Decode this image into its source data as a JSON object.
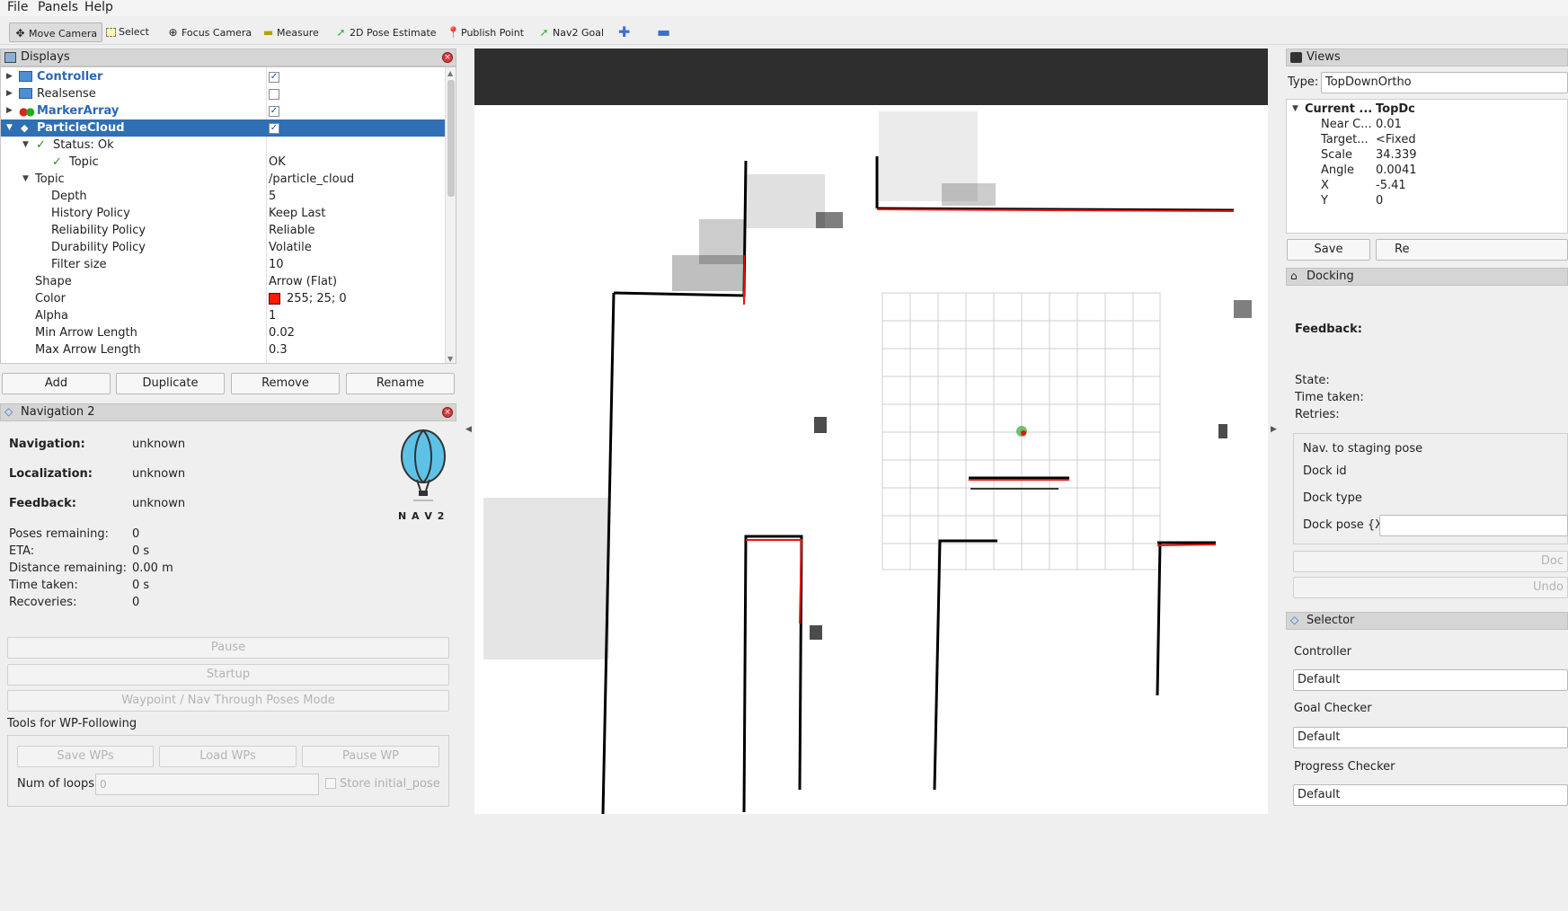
{
  "menu": {
    "file": "File",
    "panels": "Panels",
    "help": "Help"
  },
  "toolbar": {
    "move_camera": "Move Camera",
    "select": "Select",
    "focus_camera": "Focus Camera",
    "measure": "Measure",
    "pose_estimate": "2D Pose Estimate",
    "publish_point": "Publish Point",
    "nav2_goal": "Nav2 Goal"
  },
  "displays": {
    "title": "Displays",
    "items": [
      {
        "label": "Controller",
        "checked": true
      },
      {
        "label": "Realsense",
        "checked": false
      },
      {
        "label": "MarkerArray",
        "checked": true
      },
      {
        "label": "ParticleCloud",
        "checked": true
      }
    ],
    "status": "Status: Ok",
    "topic_status_label": "Topic",
    "topic_status_value": "OK",
    "props": {
      "topic": {
        "label": "Topic",
        "value": "/particle_cloud"
      },
      "depth": {
        "label": "Depth",
        "value": "5"
      },
      "history": {
        "label": "History Policy",
        "value": "Keep Last"
      },
      "reliability": {
        "label": "Reliability Policy",
        "value": "Reliable"
      },
      "durability": {
        "label": "Durability Policy",
        "value": "Volatile"
      },
      "filter": {
        "label": "Filter size",
        "value": "10"
      },
      "shape": {
        "label": "Shape",
        "value": "Arrow (Flat)"
      },
      "color": {
        "label": "Color",
        "value": "255; 25; 0",
        "swatch": "#ff1900"
      },
      "alpha": {
        "label": "Alpha",
        "value": "1"
      },
      "min_arrow": {
        "label": "Min Arrow Length",
        "value": "0.02"
      },
      "max_arrow": {
        "label": "Max Arrow Length",
        "value": "0.3"
      }
    },
    "buttons": {
      "add": "Add",
      "duplicate": "Duplicate",
      "remove": "Remove",
      "rename": "Rename"
    }
  },
  "nav2": {
    "title": "Navigation 2",
    "logo_text": "N A V 2",
    "navigation": {
      "label": "Navigation:",
      "value": "unknown"
    },
    "localization": {
      "label": "Localization:",
      "value": "unknown"
    },
    "feedback": {
      "label": "Feedback:",
      "value": "unknown"
    },
    "poses_remaining": {
      "label": "Poses remaining:",
      "value": "0"
    },
    "eta": {
      "label": "ETA:",
      "value": "0 s"
    },
    "distance": {
      "label": "Distance remaining:",
      "value": "0.00 m"
    },
    "time_taken": {
      "label": "Time taken:",
      "value": "0 s"
    },
    "recoveries": {
      "label": "Recoveries:",
      "value": "0"
    },
    "pause": "Pause",
    "startup": "Startup",
    "waypoint_mode": "Waypoint / Nav Through Poses Mode",
    "wp_tools": "Tools for WP-Following",
    "save_wps": "Save WPs",
    "load_wps": "Load WPs",
    "pause_wp": "Pause WP",
    "num_loops": "Num of loops",
    "num_loops_value": "0",
    "store_initial": "Store initial_pose"
  },
  "views": {
    "title": "Views",
    "type_label": "Type:",
    "type_value": "TopDownOrtho",
    "col_name": "Current ...",
    "col_value": "TopDc",
    "rows": [
      {
        "k": "Near C...",
        "v": "0.01"
      },
      {
        "k": "Target...",
        "v": "<Fixed"
      },
      {
        "k": "Scale",
        "v": "34.339"
      },
      {
        "k": "Angle",
        "v": "0.0041"
      },
      {
        "k": "X",
        "v": "-5.41"
      },
      {
        "k": "Y",
        "v": "0"
      }
    ],
    "save": "Save",
    "remove": "Re"
  },
  "docking": {
    "title": "Docking",
    "feedback": "Feedback:",
    "state": "State:",
    "time_taken": "Time taken:",
    "retries": "Retries:",
    "nav_staging": "Nav. to staging pose",
    "dock_id": "Dock id",
    "dock_type": "Dock type",
    "dock_pose": "Dock pose {X",
    "dock_btn": "Doc",
    "undock_btn": "Undo"
  },
  "selector": {
    "title": "Selector",
    "controller_label": "Controller",
    "controller_value": "Default",
    "goal_checker_label": "Goal Checker",
    "goal_checker_value": "Default",
    "progress_checker_label": "Progress Checker",
    "progress_checker_value": "Default"
  }
}
